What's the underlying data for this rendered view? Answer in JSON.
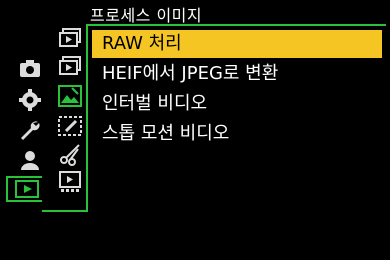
{
  "header": {
    "title": "프로세스 이미지"
  },
  "menu": {
    "items": [
      {
        "label": "RAW 처리",
        "selected": true
      },
      {
        "label": "HEIF에서 JPEG로 변환",
        "selected": false
      },
      {
        "label": "인터벌 비디오",
        "selected": false
      },
      {
        "label": "스톱 모션 비디오",
        "selected": false
      }
    ]
  },
  "categories": [
    "camera-icon",
    "gear-icon",
    "wrench-icon",
    "person-icon",
    "playback-icon"
  ],
  "sub_tabs": [
    "playback-mode-1-icon",
    "playback-mode-2-icon",
    "process-image-icon",
    "edit-icon",
    "scissors-icon",
    "playback-other-icon"
  ],
  "colors": {
    "accent_green": "#29c23a",
    "highlight_yellow": "#f5c623",
    "background": "#000000",
    "icon_gray": "#dcdcdc"
  }
}
